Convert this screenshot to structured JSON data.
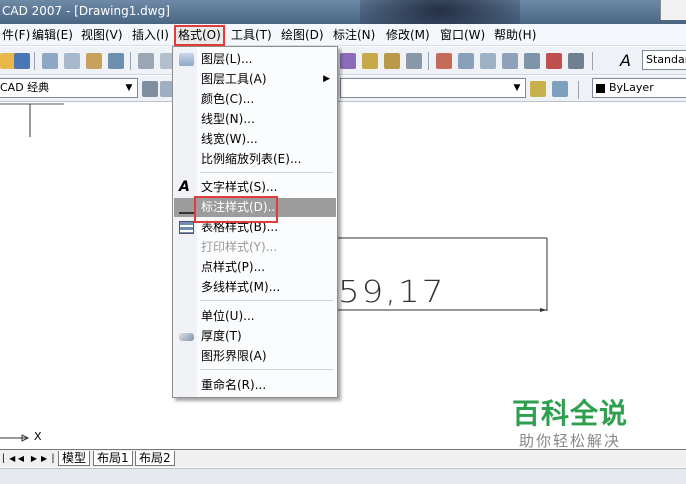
{
  "window": {
    "title": "CAD 2007 - [Drawing1.dwg]"
  },
  "menubar": {
    "items": [
      {
        "key": "file",
        "label": "件(F)"
      },
      {
        "key": "edit",
        "label": "编辑(E)"
      },
      {
        "key": "view",
        "label": "视图(V)"
      },
      {
        "key": "insert",
        "label": "插入(I)"
      },
      {
        "key": "format",
        "label": "格式(O)"
      },
      {
        "key": "tools",
        "label": "工具(T)"
      },
      {
        "key": "draw",
        "label": "绘图(D)"
      },
      {
        "key": "dimension",
        "label": "标注(N)"
      },
      {
        "key": "modify",
        "label": "修改(M)"
      },
      {
        "key": "window",
        "label": "窗口(W)"
      },
      {
        "key": "help",
        "label": "帮助(H)"
      }
    ]
  },
  "toolbar": {
    "workspace": "CAD 经典",
    "text_style": "Standar",
    "layer": "ByLayer"
  },
  "format_menu": {
    "items": [
      {
        "label": "图层(L)...",
        "icon": "layers-icon"
      },
      {
        "label": "图层工具(A)",
        "submenu": true
      },
      {
        "label": "颜色(C)..."
      },
      {
        "label": "线型(N)..."
      },
      {
        "label": "线宽(W)..."
      },
      {
        "label": "比例缩放列表(E)..."
      },
      {
        "label": "文字样式(S)...",
        "icon": "text-style-icon"
      },
      {
        "label": "标注样式(D)...",
        "icon": "dimension-style-icon",
        "selected": true
      },
      {
        "label": "表格样式(B)...",
        "icon": "table-style-icon"
      },
      {
        "label": "打印样式(Y)...",
        "disabled": true
      },
      {
        "label": "点样式(P)..."
      },
      {
        "label": "多线样式(M)..."
      },
      {
        "label": "单位(U)..."
      },
      {
        "label": "厚度(T)",
        "icon": "thickness-icon"
      },
      {
        "label": "图形界限(A)"
      },
      {
        "label": "重命名(R)..."
      }
    ]
  },
  "drawing": {
    "dimension_text": "59,17",
    "x_axis_label": "X"
  },
  "layout_tabs": {
    "model": "模型",
    "layout1": "布局1",
    "layout2": "布局2"
  },
  "watermark": {
    "main": "百科全说",
    "sub": "助你轻松解决"
  },
  "colors": {
    "highlight_box": "#e23b3b",
    "selected_item": "#9c9c9c",
    "watermark_green": "#2e9e4f"
  }
}
